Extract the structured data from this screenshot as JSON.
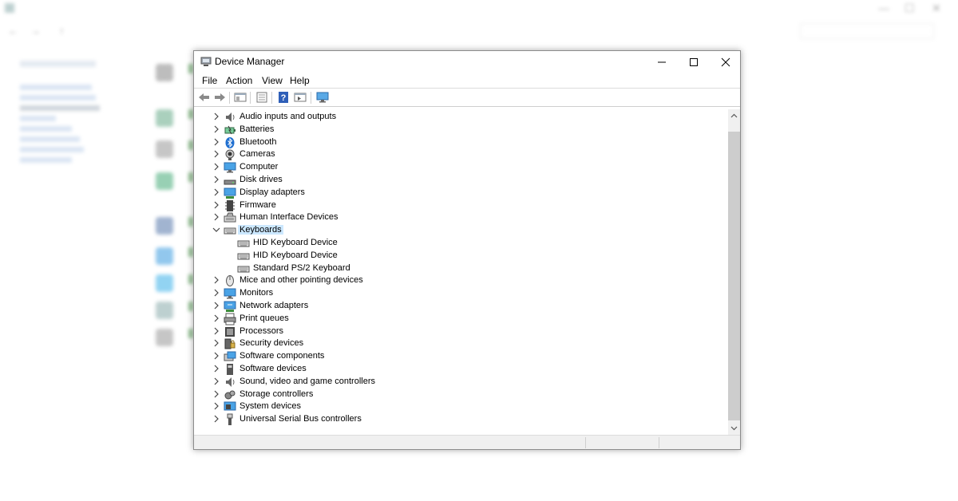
{
  "window": {
    "title": "Device Manager",
    "controls": [
      "minimize",
      "maximize",
      "close"
    ]
  },
  "menu": {
    "file": "File",
    "action": "Action",
    "view": "View",
    "help": "Help"
  },
  "toolbar": {
    "buttons": [
      "back-arrow-icon",
      "forward-arrow-icon",
      "show-hide-console-tree-icon",
      "properties-icon",
      "help-icon",
      "action-pane-icon",
      "scan-hardware-icon"
    ]
  },
  "tree": {
    "categories": [
      {
        "label": "Audio inputs and outputs",
        "icon": "speaker-icon",
        "expanded": false
      },
      {
        "label": "Batteries",
        "icon": "battery-icon",
        "expanded": false
      },
      {
        "label": "Bluetooth",
        "icon": "bluetooth-icon",
        "expanded": false
      },
      {
        "label": "Cameras",
        "icon": "camera-icon",
        "expanded": false
      },
      {
        "label": "Computer",
        "icon": "computer-icon",
        "expanded": false
      },
      {
        "label": "Disk drives",
        "icon": "disk-drive-icon",
        "expanded": false
      },
      {
        "label": "Display adapters",
        "icon": "display-adapter-icon",
        "expanded": false
      },
      {
        "label": "Firmware",
        "icon": "firmware-icon",
        "expanded": false
      },
      {
        "label": "Human Interface Devices",
        "icon": "hid-icon",
        "expanded": false
      },
      {
        "label": "Keyboards",
        "icon": "keyboard-icon",
        "expanded": true,
        "selected": true,
        "children": [
          {
            "label": "HID Keyboard Device",
            "icon": "keyboard-icon"
          },
          {
            "label": "HID Keyboard Device",
            "icon": "keyboard-icon"
          },
          {
            "label": "Standard PS/2 Keyboard",
            "icon": "keyboard-icon"
          }
        ]
      },
      {
        "label": "Mice and other pointing devices",
        "icon": "mouse-icon",
        "expanded": false
      },
      {
        "label": "Monitors",
        "icon": "monitor-icon",
        "expanded": false
      },
      {
        "label": "Network adapters",
        "icon": "network-icon",
        "expanded": false
      },
      {
        "label": "Print queues",
        "icon": "printer-icon",
        "expanded": false
      },
      {
        "label": "Processors",
        "icon": "processor-icon",
        "expanded": false
      },
      {
        "label": "Security devices",
        "icon": "security-icon",
        "expanded": false
      },
      {
        "label": "Software components",
        "icon": "software-component-icon",
        "expanded": false
      },
      {
        "label": "Software devices",
        "icon": "software-device-icon",
        "expanded": false
      },
      {
        "label": "Sound, video and game controllers",
        "icon": "sound-icon",
        "expanded": false
      },
      {
        "label": "Storage controllers",
        "icon": "storage-icon",
        "expanded": false
      },
      {
        "label": "System devices",
        "icon": "system-icon",
        "expanded": false
      },
      {
        "label": "Universal Serial Bus controllers",
        "icon": "usb-icon",
        "expanded": false
      }
    ]
  },
  "colors": {
    "selection": "#cce8ff",
    "scroll_track": "#f0f0f0",
    "scroll_thumb": "#cdcdcd",
    "icon_blue": "#3a8fd9"
  }
}
